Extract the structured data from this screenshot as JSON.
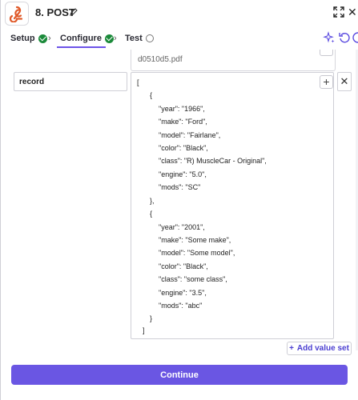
{
  "header": {
    "title": "8. POST",
    "icons": {
      "app": "webhook-icon",
      "edit": "pencil-icon",
      "expand": "expand-icon",
      "close": "close-icon"
    }
  },
  "tabs": [
    {
      "label": "Setup",
      "status": "complete"
    },
    {
      "label": "Configure",
      "status": "complete",
      "active": true
    },
    {
      "label": "Test",
      "status": "incomplete"
    }
  ],
  "toolbar": {
    "icons": [
      "sparkle-icon",
      "refresh-icon",
      "help-icon"
    ]
  },
  "fields": {
    "top_value": "d0510d5.pdf",
    "record_key": "record",
    "record_value_lines": [
      "[",
      "{",
      "\"year\": \"1966\",",
      "\"make\": \"Ford\",",
      "\"model\": \"Fairlane\",",
      "\"color\": \"Black\",",
      "\"class\": \"R) MuscleCar - Original\",",
      "\"engine\": \"5.0\",",
      "\"mods\": \"SC\"",
      "},",
      "{",
      "\"year\": \"2001\",",
      "\"make\": \"Some make\",",
      "\"model\": \"Some model\",",
      "\"color\": \"Black\",",
      "\"class\": \"some class\",",
      "\"engine\": \"3.5\",",
      "\"mods\": \"abc\"",
      "}",
      "]"
    ]
  },
  "actions": {
    "add_value_set": "Add value set",
    "continue": "Continue"
  },
  "colors": {
    "accent": "#6a56e3",
    "check_green": "#1b8a3a",
    "brand_orange": "#e05a2a"
  }
}
